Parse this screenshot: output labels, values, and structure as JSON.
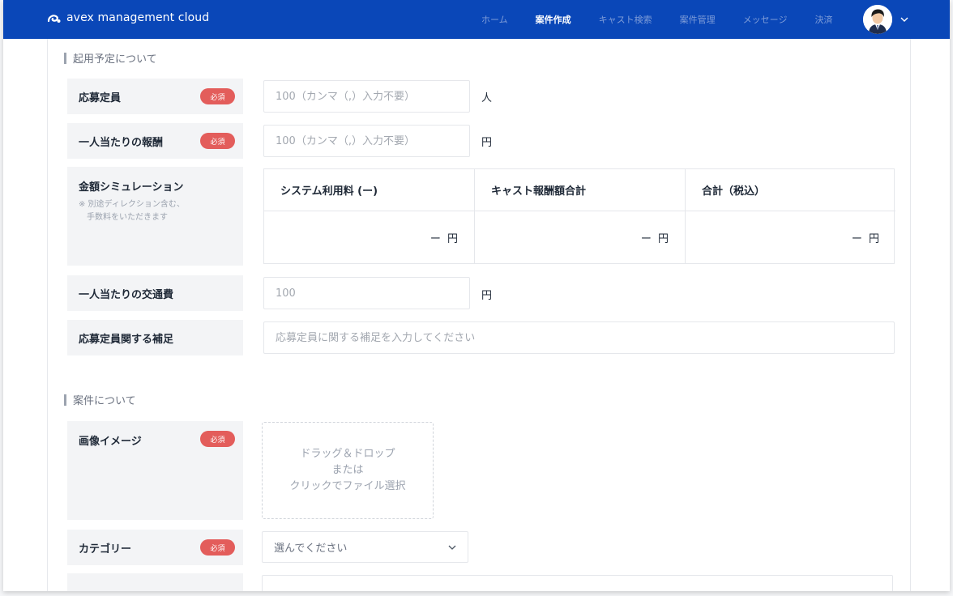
{
  "header": {
    "brand": "avex management cloud",
    "nav": [
      {
        "label": "ホーム",
        "active": false
      },
      {
        "label": "案件作成",
        "active": true
      },
      {
        "label": "キャスト検索",
        "active": false
      },
      {
        "label": "案件管理",
        "active": false
      },
      {
        "label": "メッセージ",
        "active": false
      },
      {
        "label": "決済",
        "active": false
      }
    ]
  },
  "sections": {
    "hiring": "起用予定について",
    "project": "案件について"
  },
  "fields": {
    "applicants": {
      "label": "応募定員",
      "required": "必須",
      "placeholder": "100（カンマ（,）入力不要）",
      "unit": "人"
    },
    "reward": {
      "label": "一人当たりの報酬",
      "required": "必須",
      "placeholder": "100（カンマ（,）入力不要）",
      "unit": "円"
    },
    "simulation": {
      "label": "金額シミュレーション",
      "note": "※ 別途ディレクション含む、\n　手数料をいただきます",
      "headers": [
        "システム利用料 (ー)",
        "キャスト報酬額合計",
        "合計（税込）"
      ],
      "values": [
        "ー 円",
        "ー 円",
        "ー 円"
      ]
    },
    "transport": {
      "label": "一人当たりの交通費",
      "placeholder": "100",
      "unit": "円"
    },
    "supplement": {
      "label": "応募定員関する補足",
      "placeholder": "応募定員に関する補足を入力してください"
    },
    "image": {
      "label": "画像イメージ",
      "required": "必須",
      "dropzone": "ドラッグ＆ドロップ\nまたは\nクリックでファイル選択"
    },
    "category": {
      "label": "カテゴリー",
      "required": "必須",
      "selected": "選んでください"
    }
  },
  "colors": {
    "header_bg": "#0a47b8",
    "required_badge": "#e35d5b"
  }
}
